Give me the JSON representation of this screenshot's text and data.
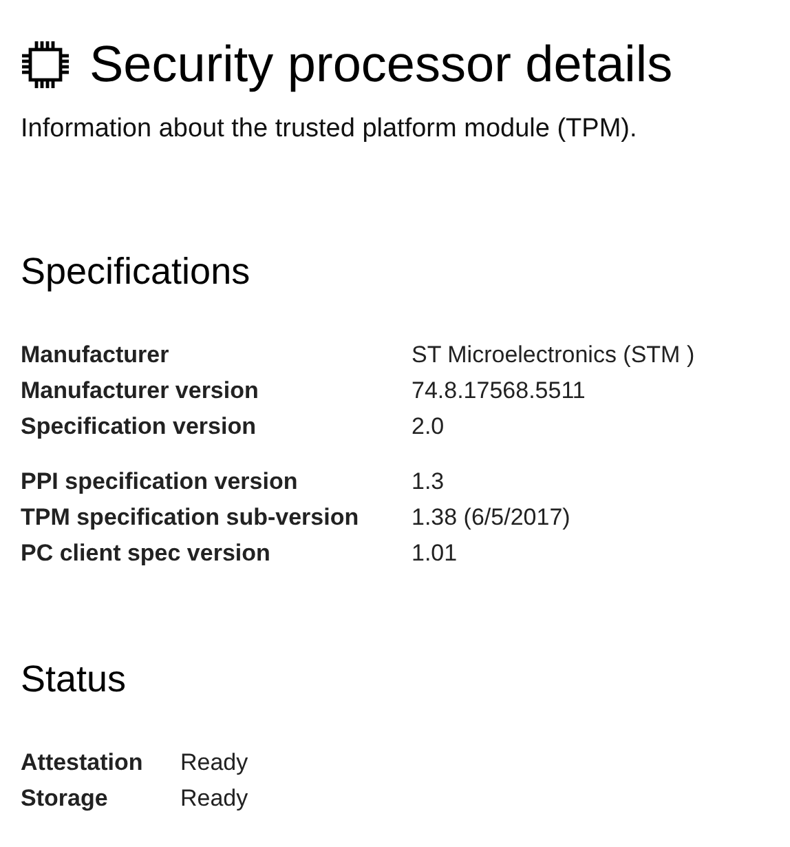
{
  "title": "Security processor details",
  "subtitle": "Information about the trusted platform module (TPM).",
  "sections": [
    {
      "heading": "Specifications",
      "groups": [
        [
          {
            "label": "Manufacturer",
            "value": "ST Microelectronics (STM )"
          },
          {
            "label": "Manufacturer version",
            "value": "74.8.17568.5511"
          },
          {
            "label": "Specification version",
            "value": "2.0"
          }
        ],
        [
          {
            "label": "PPI specification version",
            "value": "1.3"
          },
          {
            "label": "TPM specification sub-version",
            "value": "1.38 (6/5/2017)"
          },
          {
            "label": "PC client spec version",
            "value": "1.01"
          }
        ]
      ]
    },
    {
      "heading": "Status",
      "groups": [
        [
          {
            "label": "Attestation",
            "value": "Ready"
          },
          {
            "label": "Storage",
            "value": "Ready"
          }
        ]
      ]
    }
  ]
}
